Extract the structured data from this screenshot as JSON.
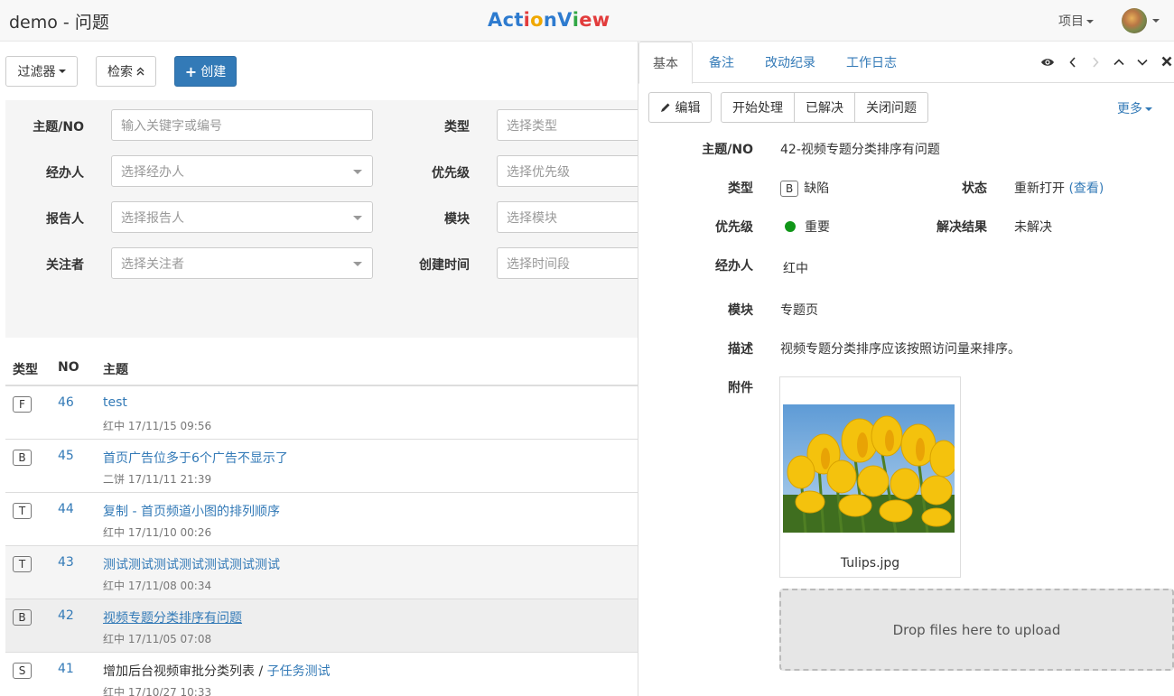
{
  "topbar": {
    "title": "demo - 问题",
    "logo_letters": [
      {
        "ch": "A",
        "color": "#2e7bcf"
      },
      {
        "ch": "c",
        "color": "#2e7bcf"
      },
      {
        "ch": "t",
        "color": "#2e7bcf"
      },
      {
        "ch": "i",
        "color": "#e23c3c"
      },
      {
        "ch": "o",
        "color": "#f0a800"
      },
      {
        "ch": "n",
        "color": "#2e7bcf"
      },
      {
        "ch": "V",
        "color": "#2e7bcf"
      },
      {
        "ch": "i",
        "color": "#31a745"
      },
      {
        "ch": "e",
        "color": "#e23c3c"
      },
      {
        "ch": "w",
        "color": "#e23c3c"
      }
    ],
    "project_menu": "项目"
  },
  "toolbar": {
    "filter_label": "过滤器",
    "search_label": "检索",
    "create_label": "创建"
  },
  "filters": {
    "subject_label": "主题/NO",
    "subject_placeholder": "输入关键字或编号",
    "assignee_label": "经办人",
    "assignee_placeholder": "选择经办人",
    "reporter_label": "报告人",
    "reporter_placeholder": "选择报告人",
    "watcher_label": "关注者",
    "watcher_placeholder": "选择关注者",
    "type_label": "类型",
    "type_placeholder": "选择类型",
    "priority_label": "优先级",
    "priority_placeholder": "选择优先级",
    "module_label": "模块",
    "module_placeholder": "选择模块",
    "created_label": "创建时间",
    "created_placeholder": "选择时间段"
  },
  "list": {
    "col_type": "类型",
    "col_no": "NO",
    "col_subject": "主题",
    "rows": [
      {
        "type": "F",
        "no": "46",
        "title": "test",
        "meta": "红中  17/11/15 09:56"
      },
      {
        "type": "B",
        "no": "45",
        "title": "首页广告位多于6个广告不显示了",
        "meta": "二饼  17/11/11 21:39"
      },
      {
        "type": "T",
        "no": "44",
        "title": "复制 - 首页频道小图的排列顺序",
        "meta": "红中  17/11/10 00:26"
      },
      {
        "type": "T",
        "no": "43",
        "title": "测试测试测试测试测试测试测试",
        "meta": "红中  17/11/08 00:34"
      },
      {
        "type": "B",
        "no": "42",
        "title": "视频专题分类排序有问题",
        "meta": "红中  17/11/05 07:08"
      },
      {
        "type": "S",
        "no": "41",
        "title": "增加后台视频审批分类列表",
        "title_sep": " / ",
        "title_sub": "子任务测试",
        "meta": "红中  17/10/27 10:33"
      }
    ]
  },
  "detail": {
    "tabs": [
      "基本",
      "备注",
      "改动纪录",
      "工作日志"
    ],
    "edit_label": "编辑",
    "start_label": "开始处理",
    "resolved_label": "已解决",
    "close_label": "关闭问题",
    "more_label": "更多",
    "fields": {
      "subject_label": "主题/NO",
      "subject_value": "42-视频专题分类排序有问题",
      "type_label": "类型",
      "type_badge": "B",
      "type_value": "缺陷",
      "status_label": "状态",
      "status_value": "重新打开",
      "status_link": "(查看)",
      "priority_label": "优先级",
      "priority_value": "重要",
      "priority_color": "#109618",
      "resolution_label": "解决结果",
      "resolution_value": "未解决",
      "assignee_label": "经办人",
      "assignee_value": "红中",
      "module_label": "模块",
      "module_value": "专题页",
      "desc_label": "描述",
      "desc_value": "视频专题分类排序应该按照访问量来排序。",
      "attach_label": "附件",
      "attach_name": "Tulips.jpg",
      "dropzone_text": "Drop files here to upload"
    }
  },
  "colors": {
    "primary": "#337ab7",
    "link": "#337ab7"
  }
}
